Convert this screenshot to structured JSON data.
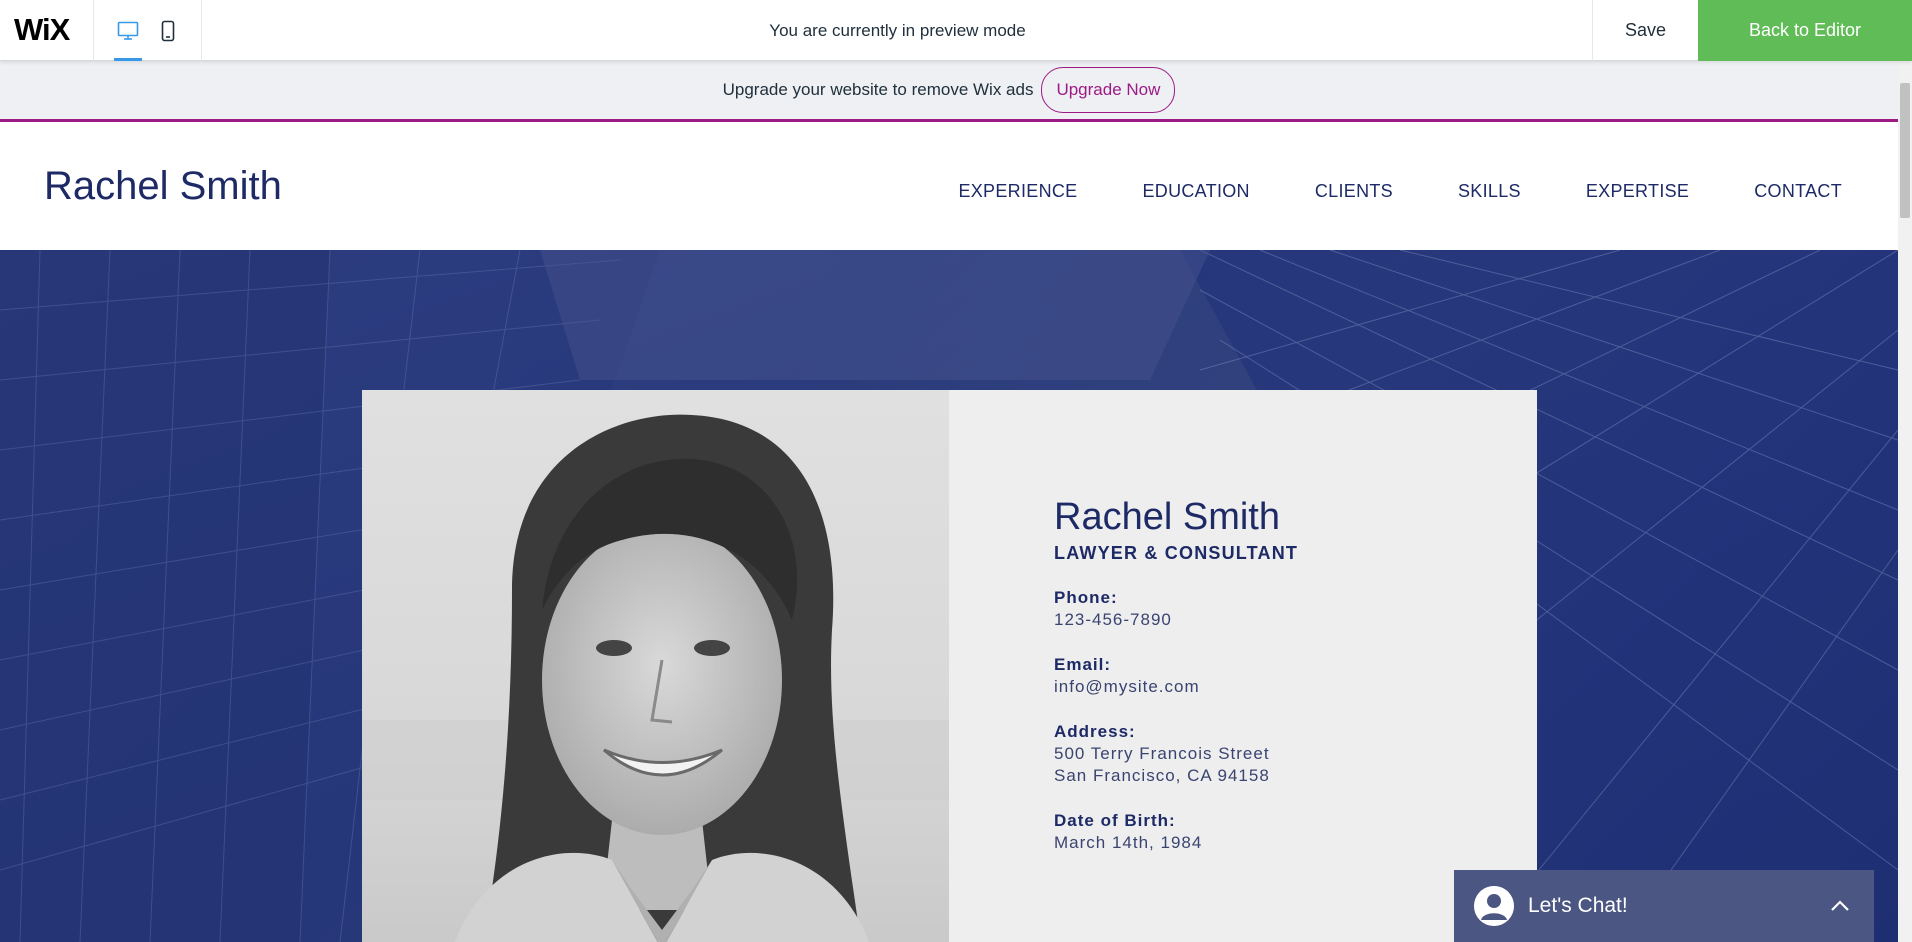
{
  "topbar": {
    "logo": "WiX",
    "preview_message": "You are currently in preview mode",
    "save_label": "Save",
    "back_label": "Back to Editor",
    "desktop_icon": "desktop-icon",
    "mobile_icon": "mobile-icon"
  },
  "banner": {
    "text": "Upgrade your website to remove Wix ads",
    "button": "Upgrade Now"
  },
  "site": {
    "name": "Rachel Smith",
    "nav": [
      "EXPERIENCE",
      "EDUCATION",
      "CLIENTS",
      "SKILLS",
      "EXPERTISE",
      "CONTACT"
    ]
  },
  "profile": {
    "name": "Rachel Smith",
    "title": "LAWYER & CONSULTANT",
    "phone_label": "Phone:",
    "phone": "123-456-7890",
    "email_label": "Email:",
    "email": "info@mysite.com",
    "address_label": "Address:",
    "address_line1": "500 Terry Francois Street",
    "address_line2": "San Francisco, CA 94158",
    "dob_label": "Date of Birth:",
    "dob": "March 14th, 1984"
  },
  "chat": {
    "label": "Let's Chat!",
    "avatar_icon": "user-icon",
    "toggle_icon": "chevron-up-icon"
  },
  "colors": {
    "brand_green": "#60bc57",
    "accent_purple": "#9c1b85",
    "navy": "#1d2a66",
    "hero_blue": "#2d3c7e",
    "chat_bg": "#4b5682"
  }
}
